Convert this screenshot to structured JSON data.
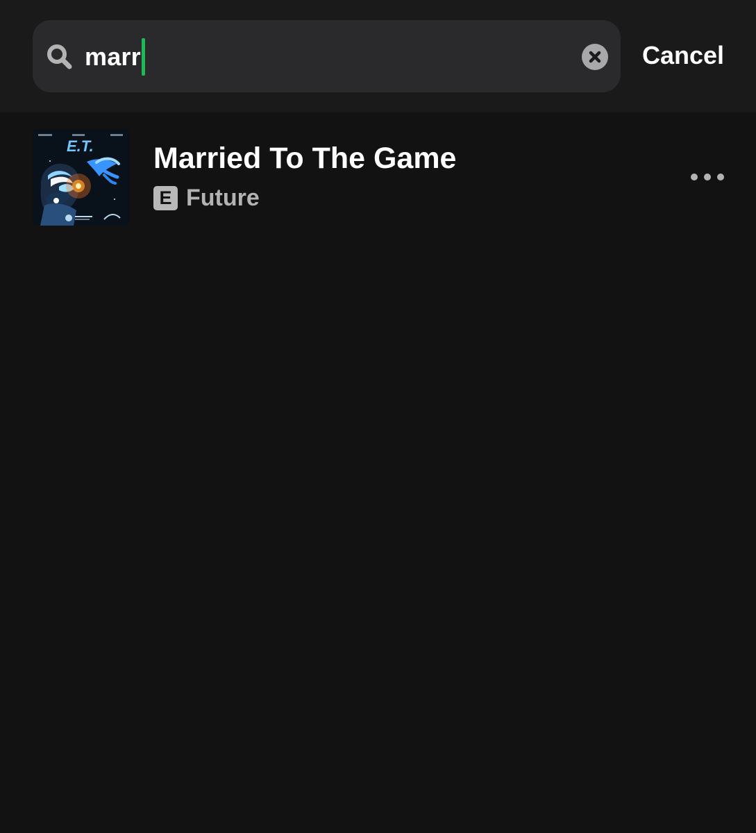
{
  "search": {
    "query": "marr",
    "cancel_label": "Cancel"
  },
  "icons": {
    "search": "search-icon",
    "clear": "clear-circle-icon",
    "more": "more-horizontal-icon",
    "explicit": "explicit-badge"
  },
  "colors": {
    "background": "#121212",
    "top_bar": "#1a1a1a",
    "search_field": "#2a2a2c",
    "caret": "#1db954",
    "secondary_text": "#b3b3b3"
  },
  "results": [
    {
      "title": "Married To The Game",
      "explicit_label": "E",
      "artist": "Future",
      "artwork": {
        "title_text": "E.T."
      }
    }
  ]
}
